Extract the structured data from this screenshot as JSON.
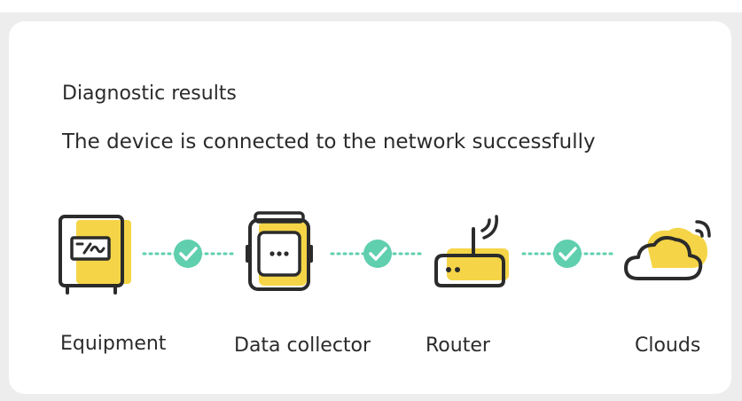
{
  "diagnostic": {
    "title": "Diagnostic results",
    "status": "The device is connected to the network successfully"
  },
  "nodes": [
    {
      "label": "Equipment",
      "icon": "inverter-icon"
    },
    {
      "label": "Data collector",
      "icon": "data-collector-icon"
    },
    {
      "label": "Router",
      "icon": "router-icon"
    },
    {
      "label": "Clouds",
      "icon": "cloud-icon"
    }
  ],
  "links": [
    {
      "status": "connected",
      "icon": "check-circle-icon"
    },
    {
      "status": "connected",
      "icon": "check-circle-icon"
    },
    {
      "status": "connected",
      "icon": "check-circle-icon"
    }
  ],
  "colors": {
    "accent_yellow": "#f5d547",
    "success_teal": "#5fcfae",
    "outline": "#2b2b2b",
    "text": "#2b2b2b"
  }
}
